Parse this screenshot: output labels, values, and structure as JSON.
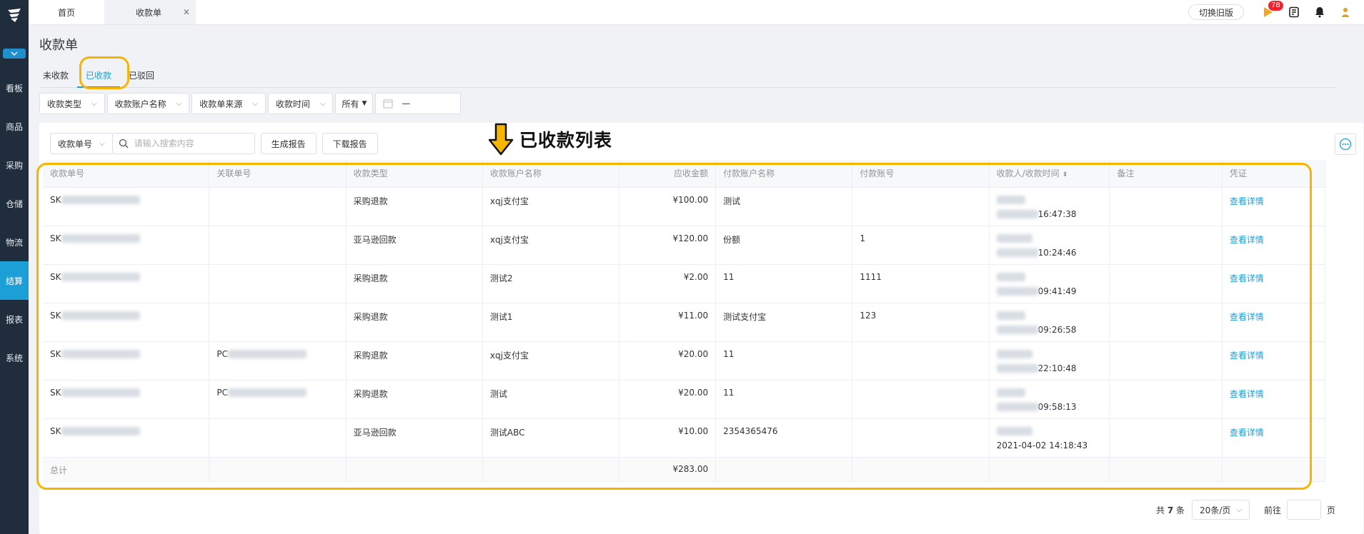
{
  "sidebar": {
    "items": [
      "看板",
      "商品",
      "采购",
      "仓储",
      "物流",
      "结算",
      "报表",
      "系统"
    ],
    "active": "结算"
  },
  "topbar": {
    "tabs": {
      "home": "首页",
      "current": "收款单"
    },
    "switch_old": "切换旧版",
    "badge_count": "78"
  },
  "page": {
    "title": "收款单",
    "status_tabs": [
      "未收款",
      "已收款",
      "已驳回"
    ],
    "active_status": "已收款"
  },
  "filters": {
    "type": "收款类型",
    "account": "收款账户名称",
    "source": "收款单来源",
    "time": "收款时间",
    "range": "所有"
  },
  "toolbar": {
    "search_field": "收款单号",
    "search_placeholder": "请输入搜索内容",
    "generate_report": "生成报告",
    "download_report": "下载报告"
  },
  "annotation": "已收款列表",
  "table": {
    "headers": [
      "收款单号",
      "关联单号",
      "收款类型",
      "收款账户名称",
      "应收金额",
      "付款账户名称",
      "付款账号",
      "收款人/收款时间",
      "备注",
      "凭证"
    ],
    "rows": [
      {
        "no": "SK",
        "rel": "",
        "type": "采购退款",
        "account": "xqj支付宝",
        "amount": "¥100.00",
        "payer": "测试",
        "payer_no": "",
        "time": "16:47:38",
        "remark": "",
        "voucher": "查看详情"
      },
      {
        "no": "SK",
        "rel": "",
        "type": "亚马逊回款",
        "account": "xqj支付宝",
        "amount": "¥120.00",
        "payer": "份额",
        "payer_no": "1",
        "time": "10:24:46",
        "remark": "",
        "voucher": "查看详情"
      },
      {
        "no": "SK",
        "rel": "",
        "type": "采购退款",
        "account": "测试2",
        "amount": "¥2.00",
        "payer": "11",
        "payer_no": "1111",
        "time": "09:41:49",
        "remark": "",
        "voucher": "查看详情"
      },
      {
        "no": "SK",
        "rel": "",
        "type": "采购退款",
        "account": "测试1",
        "amount": "¥11.00",
        "payer": "测试支付宝",
        "payer_no": "123",
        "time": "09:26:58",
        "remark": "",
        "voucher": "查看详情"
      },
      {
        "no": "SK",
        "rel": "PC",
        "type": "采购退款",
        "account": "xqj支付宝",
        "amount": "¥20.00",
        "payer": "11",
        "payer_no": "",
        "time": "22:10:48",
        "remark": "",
        "voucher": "查看详情"
      },
      {
        "no": "SK",
        "rel": "PC",
        "type": "采购退款",
        "account": "测试",
        "amount": "¥20.00",
        "payer": "11",
        "payer_no": "",
        "time": "09:58:13",
        "remark": "",
        "voucher": "查看详情"
      },
      {
        "no": "SK",
        "rel": "",
        "type": "亚马逊回款",
        "account": "测试ABC",
        "amount": "¥10.00",
        "payer": "2354365476",
        "payer_no": "",
        "time": "2021-04-02 14:18:43",
        "remark": "",
        "voucher": "查看详情"
      }
    ],
    "total_label": "总计",
    "total_amount": "¥283.00"
  },
  "pagination": {
    "total_prefix": "共",
    "total": "7",
    "total_suffix": "条",
    "page_size": "20条/页",
    "goto": "前往",
    "page_unit": "页"
  },
  "colors": {
    "accent": "#1c9fd6",
    "highlight": "#f7b500",
    "sidebar": "#1f2d3d"
  }
}
